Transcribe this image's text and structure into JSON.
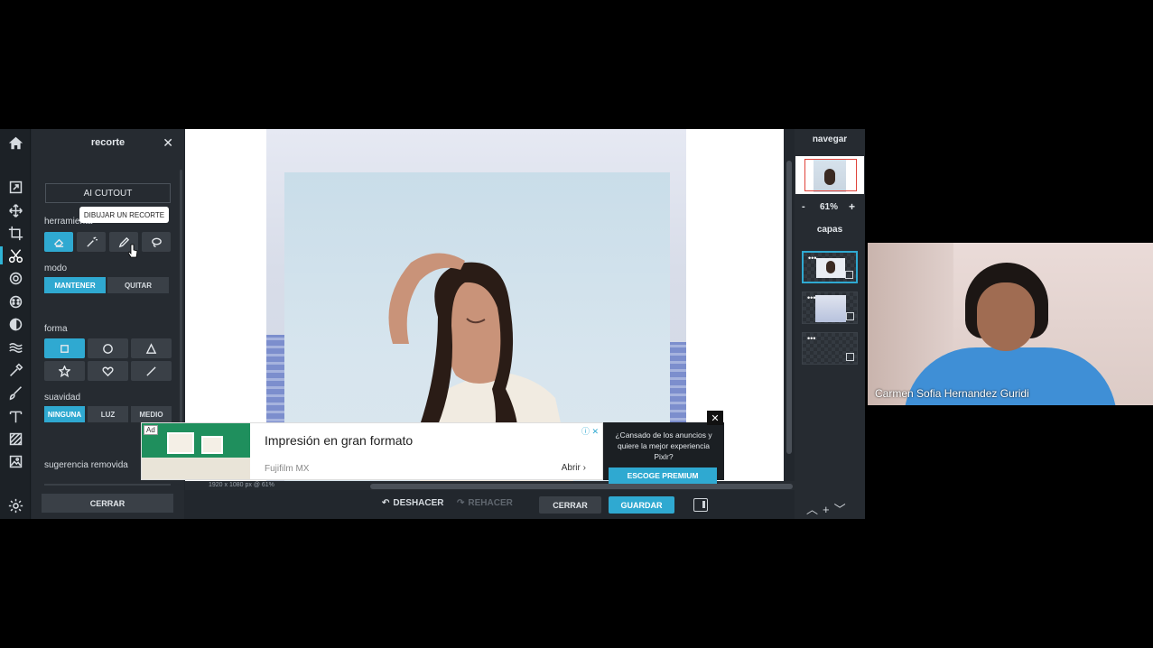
{
  "panel": {
    "title": "recorte",
    "ai_cutout": "AI CUTOUT",
    "herramienta_label": "herramienta",
    "tooltip": "DIBUJAR UN RECORTE",
    "modo_label": "modo",
    "modo_options": [
      "MANTENER",
      "QUITAR"
    ],
    "forma_label": "forma",
    "suavidad_label": "suavidad",
    "suavidad_options": [
      "NINGUNA",
      "LUZ",
      "MEDIO"
    ],
    "sugerencia_label": "sugerencia removida",
    "close_button": "CERRAR"
  },
  "canvas": {
    "info": "1920 x 1080 px @ 61%"
  },
  "bottom_bar": {
    "undo": "DESHACER",
    "redo": "REHACER",
    "close": "CERRAR",
    "save": "GUARDAR"
  },
  "right_panel": {
    "navigate_title": "navegar",
    "zoom_minus": "-",
    "zoom_value": "61%",
    "zoom_plus": "+",
    "layers_title": "capas"
  },
  "ad": {
    "badge": "Ad",
    "title": "Impresión en gran formato",
    "advertiser": "Fujifilm MX",
    "open": "Abrir",
    "premium_text": "¿Cansado de los anuncios y quiere la mejor experiencia Pixlr?",
    "premium_button": "ESCOGE PREMIUM",
    "close": "✕"
  },
  "webcam": {
    "participant_name": "Carmen Sofia Hernandez Guridi"
  },
  "colors": {
    "accent": "#2fa9d1",
    "panel_bg": "#262b31",
    "rail_bg": "#1c2126"
  }
}
